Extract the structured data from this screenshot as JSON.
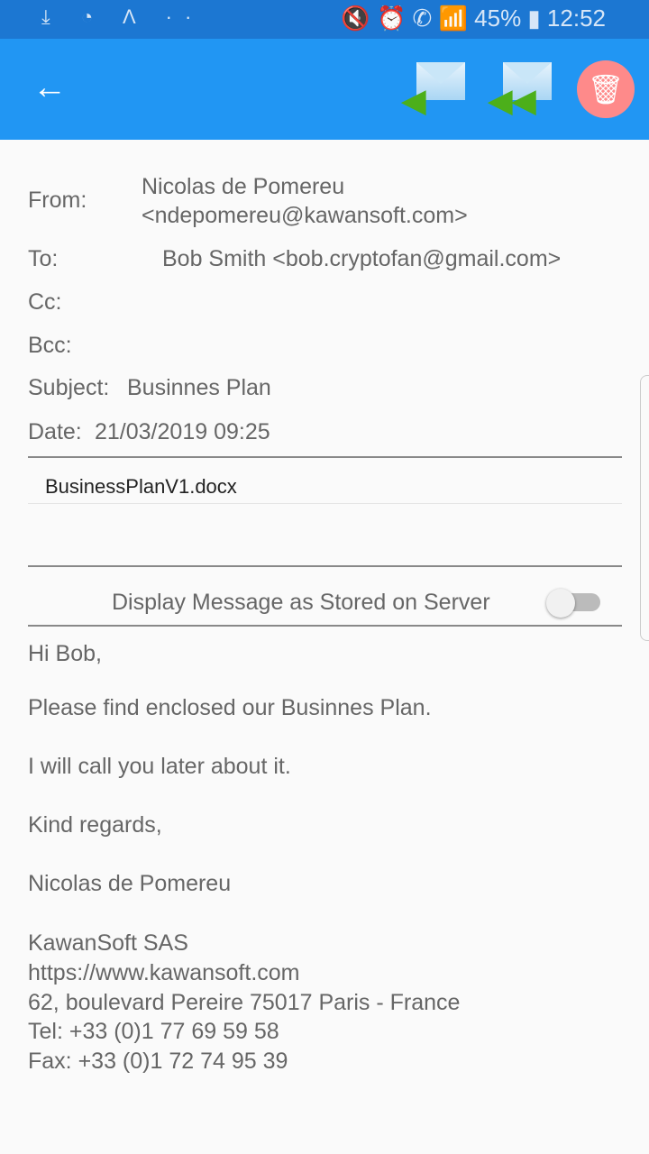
{
  "status": {
    "left_icons": "⤓ ◔ Λ ··",
    "right": "🔇 ⏰ ✆ 📶 45% ▮ 12:52",
    "battery": "45%",
    "time": "12:52"
  },
  "toolbar": {
    "back": "←",
    "reply": "reply-icon",
    "reply_all": "reply-all-icon",
    "delete": "delete-icon"
  },
  "header": {
    "from_label": "From:",
    "from_name": "Nicolas de Pomereu",
    "from_email": "<ndepomereu@kawansoft.com>",
    "to_label": "To:",
    "to_value": "Bob Smith <bob.cryptofan@gmail.com>",
    "cc_label": "Cc:",
    "bcc_label": "Bcc:",
    "subject_label": "Subject:",
    "subject_value": "Businnes Plan",
    "date_label": "Date:",
    "date_value": "21/03/2019 09:25"
  },
  "attachments": [
    "BusinessPlanV1.docx"
  ],
  "toggle": {
    "label": "Display Message as Stored on Server",
    "on": false
  },
  "body": {
    "lines": [
      "Hi Bob,",
      "Please find enclosed our Businnes Plan.",
      "I will call you later about it.",
      "Kind regards,",
      "Nicolas de Pomereu"
    ],
    "signature": [
      "KawanSoft SAS",
      "https://www.kawansoft.com",
      "62, boulevard Pereire 75017 Paris - France",
      "Tel: +33 (0)1 77 69 59 58",
      "Fax: +33 (0)1 72 74 95 39"
    ]
  }
}
